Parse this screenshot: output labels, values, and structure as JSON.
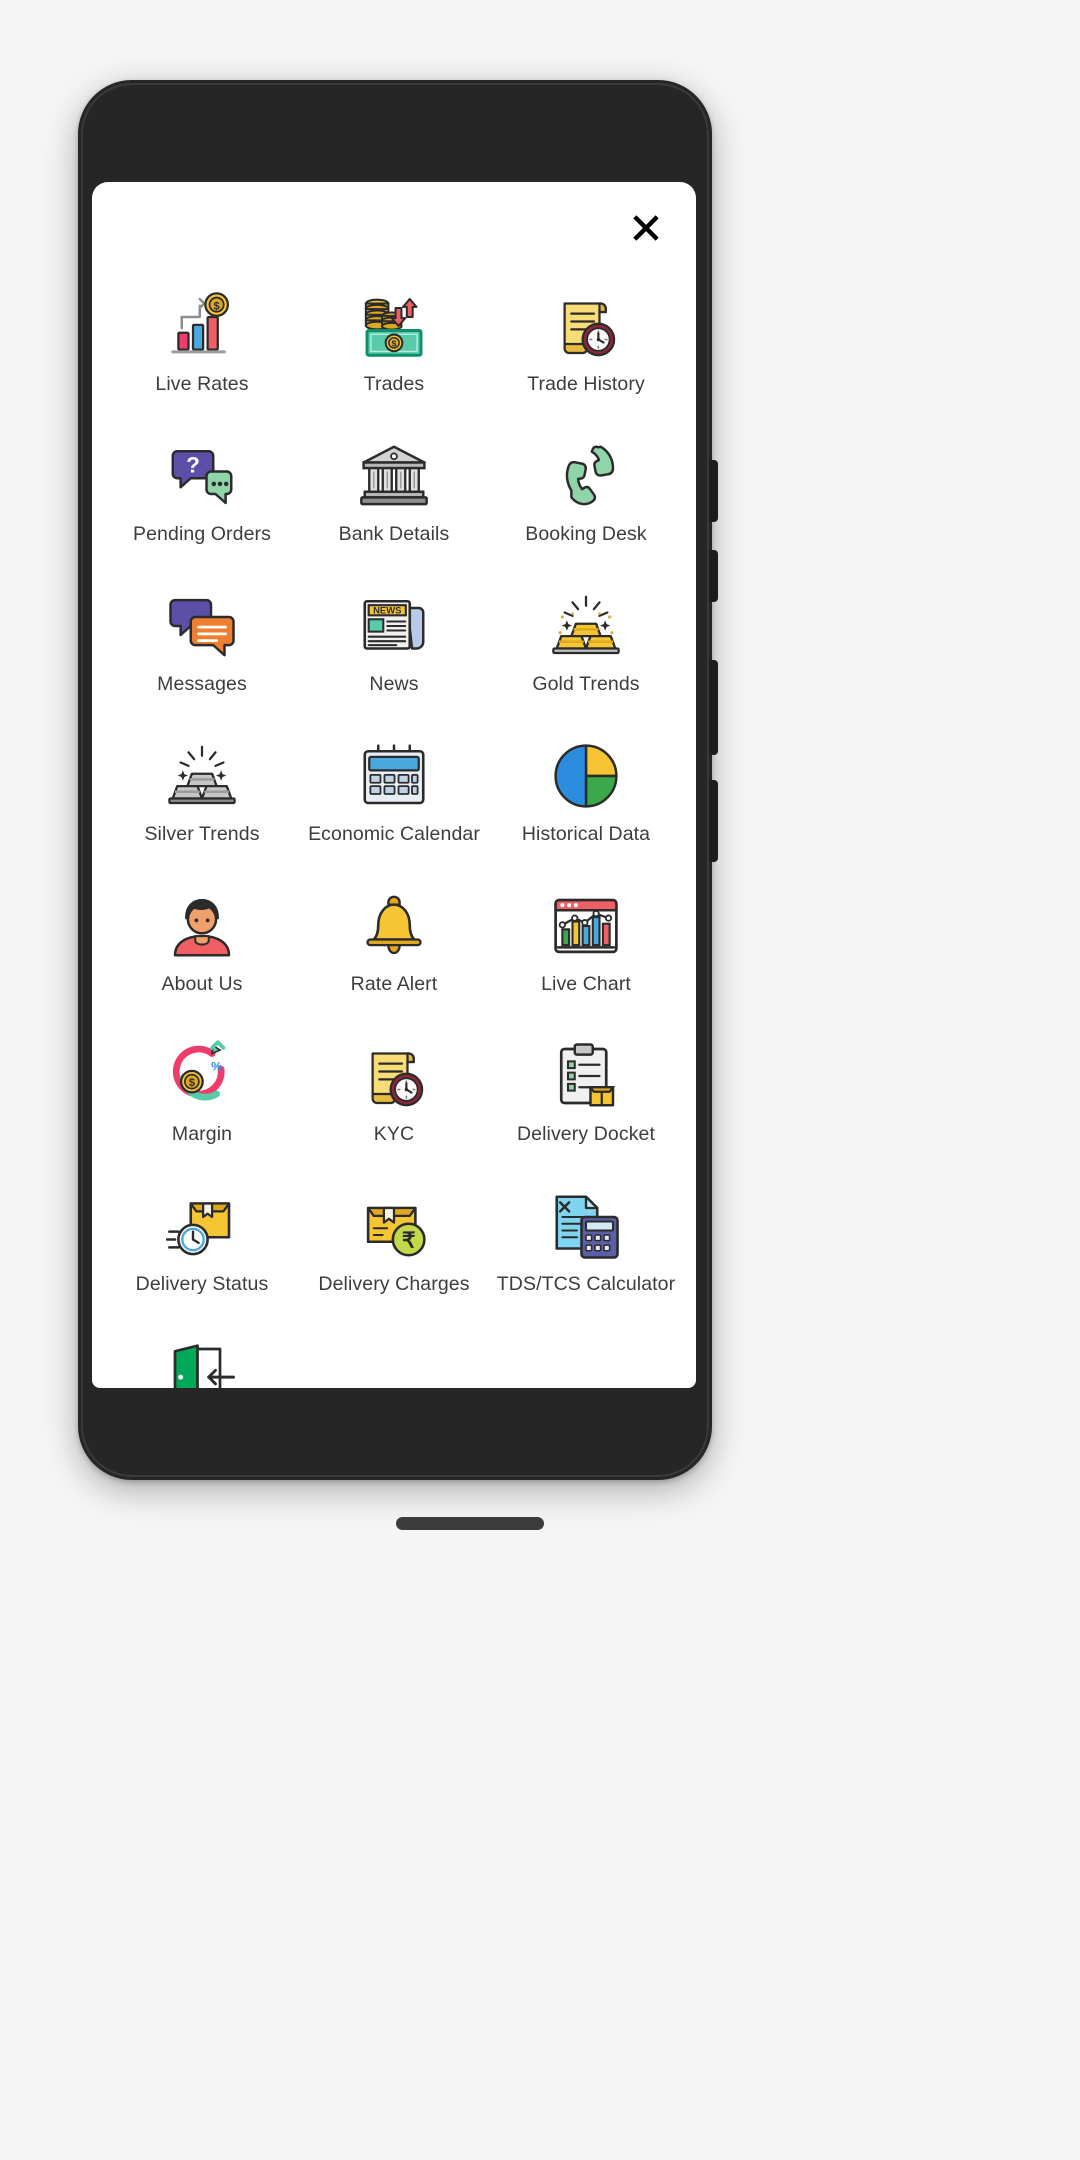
{
  "app": {
    "background_color": "#f5f5f5",
    "device_frame_color": "#262626",
    "screen_background": "#ffffff"
  },
  "header": {
    "close_label": "✕",
    "close_icon": "close-x-icon"
  },
  "menu": {
    "columns": 3,
    "items": [
      {
        "label": "Live Rates",
        "icon": "bar-chart-dollar-icon"
      },
      {
        "label": "Trades",
        "icon": "coins-banknote-arrows-icon"
      },
      {
        "label": "Trade History",
        "icon": "scroll-clock-icon"
      },
      {
        "label": "Pending Orders",
        "icon": "question-chat-bubbles-icon"
      },
      {
        "label": "Bank Details",
        "icon": "bank-building-icon"
      },
      {
        "label": "Booking Desk",
        "icon": "phone-handset-icon"
      },
      {
        "label": "Messages",
        "icon": "chat-bubbles-icon"
      },
      {
        "label": "News",
        "icon": "newspaper-icon"
      },
      {
        "label": "Gold Trends",
        "icon": "gold-bars-icon"
      },
      {
        "label": "Silver Trends",
        "icon": "silver-bars-icon"
      },
      {
        "label": "Economic Calendar",
        "icon": "calendar-icon"
      },
      {
        "label": "Historical Data",
        "icon": "pie-chart-icon"
      },
      {
        "label": "About Us",
        "icon": "person-avatar-icon"
      },
      {
        "label": "Rate Alert",
        "icon": "bell-icon"
      },
      {
        "label": "Live Chart",
        "icon": "chart-window-icon"
      },
      {
        "label": "Margin",
        "icon": "circular-arrows-dollar-icon"
      },
      {
        "label": "KYC",
        "icon": "scroll-clock-icon"
      },
      {
        "label": "Delivery Docket",
        "icon": "clipboard-box-icon"
      },
      {
        "label": "Delivery Status",
        "icon": "box-speed-clock-icon"
      },
      {
        "label": "Delivery Charges",
        "icon": "box-rupee-coin-icon"
      },
      {
        "label": "TDS/TCS Calculator",
        "icon": "document-calculator-icon"
      },
      {
        "label": "",
        "icon": "logout-door-icon"
      }
    ]
  },
  "colors": {
    "label_text": "#3d3d3d",
    "gold": "#f5c534",
    "gold_dark": "#e0a81e",
    "red": "#ef5f63",
    "pink": "#ee3d6b",
    "blue": "#4aa8e0",
    "teal": "#57cbaa",
    "green": "#00a859",
    "purple": "#5b4fa8",
    "orange": "#ef7f30",
    "silver": "#9b9b9b",
    "dark_red": "#8c2638"
  }
}
